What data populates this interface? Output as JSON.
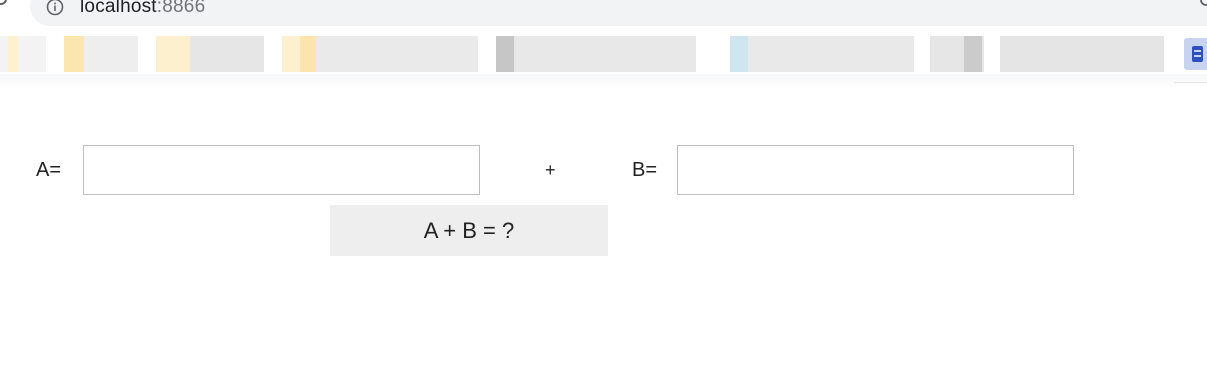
{
  "browser": {
    "url_host": "localhost",
    "url_port": ":8866",
    "icons": {
      "reload": "reload-icon",
      "info": "info-icon",
      "zoom": "zoom-icon",
      "extension": "bookmark-icon"
    },
    "bookmarks_bar": {
      "blurred_palette": [
        "#f3f3f3",
        "#fdf3d4",
        "#e9e9e9",
        "#c7c7c7",
        "#cfe4ee",
        "#dddddd"
      ]
    }
  },
  "form": {
    "label_a": "A=",
    "plus_label": "+",
    "label_b": "B=",
    "input_a_value": "",
    "input_b_value": "",
    "submit_label": "A + B = ?"
  }
}
